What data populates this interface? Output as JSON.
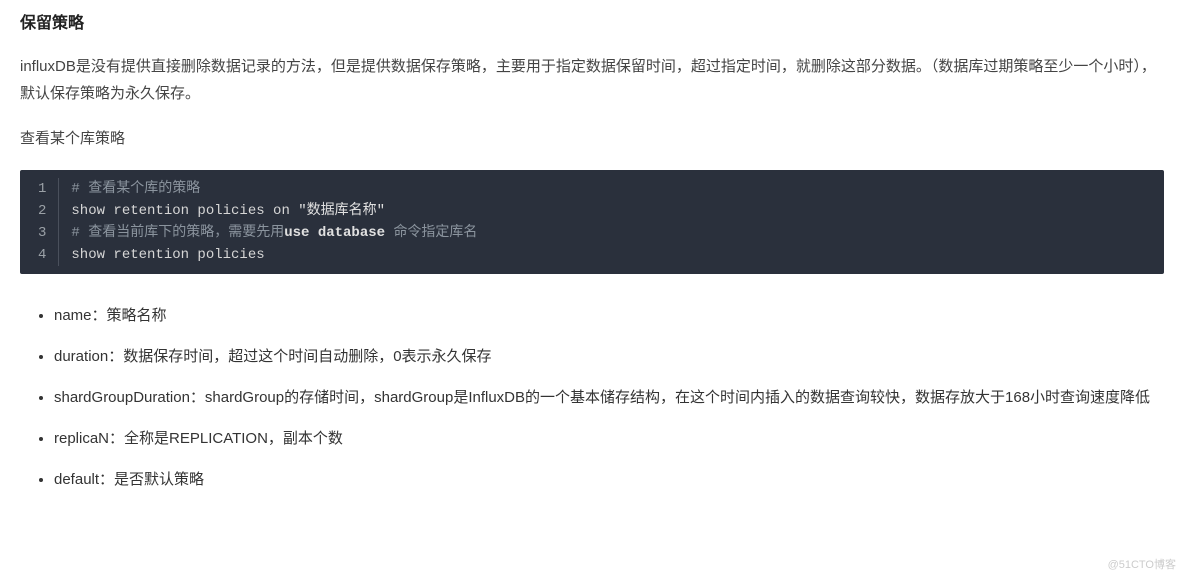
{
  "heading": "保留策略",
  "para1": "influxDB是没有提供直接删除数据记录的方法，但是提供数据保存策略，主要用于指定数据保留时间，超过指定时间，就删除这部分数据。（数据库过期策略至少一个小时），默认保存策略为永久保存。",
  "para2": "查看某个库策略",
  "code": {
    "lines": [
      {
        "n": "1",
        "segments": [
          {
            "cls": "comment",
            "t": "# 查看某个库的策略"
          }
        ]
      },
      {
        "n": "2",
        "segments": [
          {
            "cls": "plain",
            "t": "show retention policies on "
          },
          {
            "cls": "str",
            "t": "\"数据库名称\""
          }
        ]
      },
      {
        "n": "3",
        "segments": [
          {
            "cls": "comment",
            "t": "# 查看当前库下的策略，需要先用"
          },
          {
            "cls": "kw",
            "t": "use database "
          },
          {
            "cls": "comment",
            "t": "命令指定库名"
          }
        ]
      },
      {
        "n": "4",
        "segments": [
          {
            "cls": "plain",
            "t": "show retention policies"
          }
        ]
      }
    ]
  },
  "bullets": [
    "name：策略名称",
    "duration：数据保存时间，超过这个时间自动删除，0表示永久保存",
    "shardGroupDuration：shardGroup的存储时间，shardGroup是InfluxDB的一个基本储存结构，在这个时间内插入的数据查询较快，数据存放大于168小时查询速度降低",
    "replicaN：全称是REPLICATION，副本个数",
    "default：是否默认策略"
  ],
  "watermark": "@51CTO博客"
}
